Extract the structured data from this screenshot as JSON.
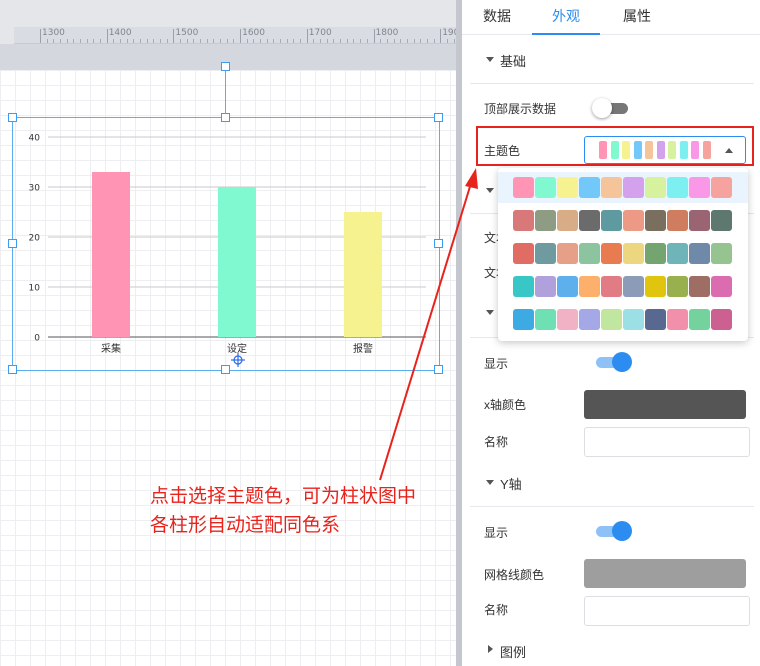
{
  "ruler": {
    "labels": [
      "1300",
      "1400",
      "1500",
      "1600",
      "1700",
      "1800",
      "1900"
    ]
  },
  "chart_data": {
    "type": "bar",
    "categories": [
      "采集",
      "设定",
      "报警"
    ],
    "values": [
      33,
      30,
      25
    ],
    "colors": [
      "#ff94b4",
      "#80f8d0",
      "#f6f290"
    ],
    "yticks": [
      0,
      10,
      20,
      30,
      40
    ],
    "ylim": [
      0,
      40
    ],
    "grid": true,
    "title": "",
    "xlabel": "",
    "ylabel": ""
  },
  "panel": {
    "tabs": [
      {
        "label": "数据",
        "active": false
      },
      {
        "label": "外观",
        "active": true
      },
      {
        "label": "属性",
        "active": false
      }
    ],
    "basic_section": "基础",
    "top_data_label": "顶部展示数据",
    "top_data_enabled": false,
    "theme_label": "主题色",
    "theme_selected": [
      "#ff94b4",
      "#80f8d0",
      "#f6f290",
      "#72c8f8",
      "#f6c49a",
      "#d4a2ec",
      "#d6f29e",
      "#7cf0f0",
      "#f898e6",
      "#f6a29e"
    ],
    "title_caret_label": "",
    "text_label_1": "文本",
    "text_label_2": "文本",
    "x_show_label": "显示",
    "x_show_enabled": true,
    "x_color_label": "x轴颜色",
    "x_color": "#555555",
    "x_name_label": "名称",
    "x_name_value": "",
    "y_axis_section": "Y轴",
    "y_show_label": "显示",
    "y_show_enabled": true,
    "y_grid_color_label": "网格线颜色",
    "y_grid_color": "#9e9e9e",
    "y_name_label": "名称",
    "y_name_value": "",
    "legend_section": "图例"
  },
  "theme_palettes": [
    [
      "#ff94b4",
      "#80f8d0",
      "#f6f290",
      "#72c8f8",
      "#f6c49a",
      "#d4a2ec",
      "#d6f29e",
      "#7cf0f0",
      "#f898e6",
      "#f6a29e"
    ],
    [
      "#d97878",
      "#8e9c84",
      "#d8ac86",
      "#6b6b6b",
      "#5e9aa0",
      "#ec9a86",
      "#7a6e5e",
      "#d07c5e",
      "#9a6472",
      "#5e7870"
    ],
    [
      "#e06c64",
      "#6e9aa0",
      "#e6a088",
      "#8cc4a0",
      "#e87c50",
      "#ecd680",
      "#74a470",
      "#6eb4b8",
      "#6e8aa8",
      "#96c490"
    ],
    [
      "#38c6c6",
      "#b0a0dc",
      "#5eb0ec",
      "#fcb06c",
      "#e27c84",
      "#8c9cb8",
      "#e0c40e",
      "#98b04e",
      "#9e6e64",
      "#dc6cb0"
    ],
    [
      "#3eaae4",
      "#6ee0b4",
      "#f2b2c6",
      "#a4a8e6",
      "#c0e6a0",
      "#9ce0e6",
      "#586890",
      "#f290ac",
      "#74d29c",
      "#cc6090"
    ]
  ],
  "annotation_text_line1": "点击选择主题色，可为柱状图中",
  "annotation_text_line2": "各柱形自动适配同色系",
  "colors": {
    "accent": "#2d8cf0",
    "annotation": "#e8231c"
  }
}
